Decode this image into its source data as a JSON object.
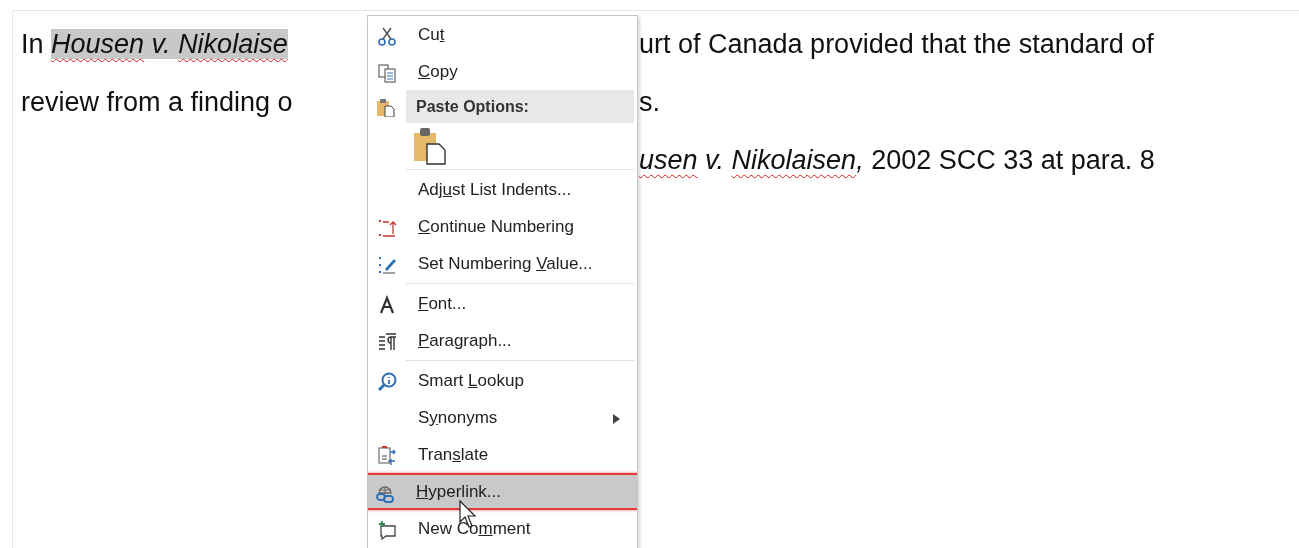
{
  "document": {
    "lines": [
      {
        "left": [
          {
            "text": "In ",
            "italic": false,
            "highlighted": false,
            "spell_error": false
          },
          {
            "text": "Housen",
            "italic": true,
            "highlighted": true,
            "spell_error": true
          },
          {
            "text": " v. ",
            "italic": true,
            "highlighted": true,
            "spell_error": false
          },
          {
            "text": "Nikolaise",
            "italic": true,
            "highlighted": true,
            "spell_error": true
          }
        ],
        "right": [
          {
            "text": "urt of Canada provided that the standard of",
            "italic": false,
            "highlighted": false,
            "spell_error": false
          }
        ]
      },
      {
        "left": [
          {
            "text": "review from a finding o",
            "italic": false,
            "highlighted": false,
            "spell_error": false
          }
        ],
        "right": [
          {
            "text": "s.",
            "italic": false,
            "highlighted": false,
            "spell_error": false
          }
        ]
      },
      {
        "right": [
          {
            "text": "usen",
            "italic": true,
            "highlighted": false,
            "spell_error": true
          },
          {
            "text": " v. ",
            "italic": true,
            "highlighted": false,
            "spell_error": false
          },
          {
            "text": "Nikolaisen",
            "italic": true,
            "highlighted": false,
            "spell_error": true
          },
          {
            "text": ",",
            "italic": true,
            "highlighted": false,
            "spell_error": false
          },
          {
            "text": " 2002 SCC 33 at para. 8",
            "italic": false,
            "highlighted": false,
            "spell_error": false
          }
        ]
      }
    ]
  },
  "context_menu": {
    "items": [
      {
        "kind": "item",
        "pre": "Cu",
        "key": "t",
        "selected": false,
        "submenu": false,
        "outlined": false
      },
      {
        "kind": "item",
        "key": "C",
        "post": "opy",
        "selected": false,
        "submenu": false,
        "outlined": false
      },
      {
        "kind": "header",
        "text": "Paste Options:"
      },
      {
        "kind": "paste"
      },
      {
        "kind": "separator"
      },
      {
        "kind": "item",
        "pre": "Adj",
        "key": "u",
        "post": "st List Indents...",
        "selected": false,
        "submenu": false,
        "outlined": false
      },
      {
        "kind": "item",
        "key": "C",
        "post": "ontinue Numbering",
        "selected": false,
        "submenu": false,
        "outlined": false
      },
      {
        "kind": "item",
        "pre": "Set Numbering ",
        "key": "V",
        "post": "alue...",
        "selected": false,
        "submenu": false,
        "outlined": false
      },
      {
        "kind": "separator"
      },
      {
        "kind": "item",
        "key": "F",
        "post": "ont...",
        "selected": false,
        "submenu": false,
        "outlined": false
      },
      {
        "kind": "item",
        "key": "P",
        "post": "aragraph...",
        "selected": false,
        "submenu": false,
        "outlined": false
      },
      {
        "kind": "separator"
      },
      {
        "kind": "item",
        "pre": "Smart ",
        "key": "L",
        "post": "ookup",
        "selected": false,
        "submenu": false,
        "outlined": false
      },
      {
        "kind": "item",
        "pre": "S",
        "key": "y",
        "post": "nonyms",
        "selected": false,
        "submenu": true,
        "outlined": false
      },
      {
        "kind": "item",
        "pre": "Tran",
        "key": "s",
        "post": "late",
        "selected": false,
        "submenu": false,
        "outlined": false
      },
      {
        "kind": "item",
        "key": "H",
        "post": "yperlink...",
        "selected": true,
        "submenu": false,
        "outlined": true
      },
      {
        "kind": "item",
        "pre": "New Co",
        "key": "m",
        "post": "ment",
        "selected": false,
        "submenu": false,
        "outlined": false
      }
    ]
  }
}
